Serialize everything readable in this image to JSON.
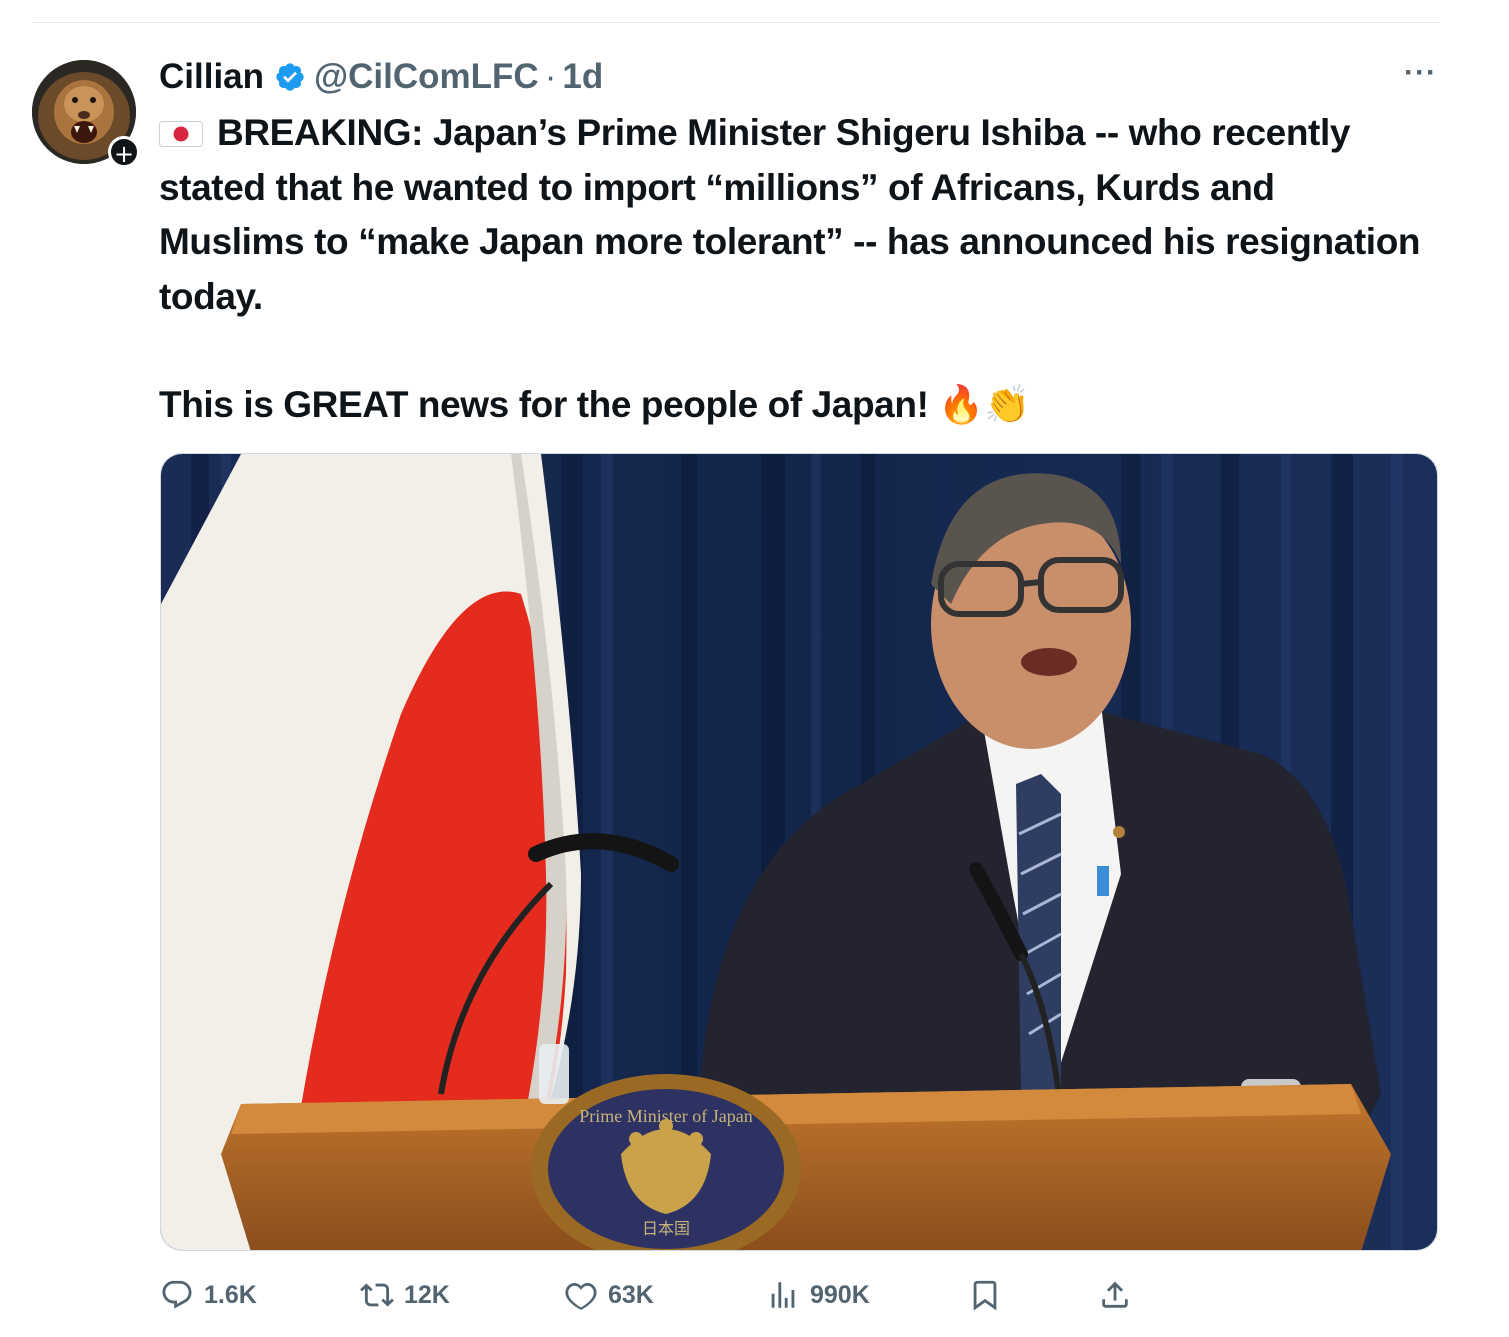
{
  "tweet": {
    "author": {
      "display_name": "Cillian",
      "handle": "@CilComLFC",
      "verified": true,
      "follow_badge": "+"
    },
    "time": "1d",
    "separator": "·",
    "more_label": "···",
    "flag_emoji": "japan-flag",
    "text_p1": "BREAKING: Japan’s Prime Minister Shigeru Ishiba -- who recently stated that he wanted to import “millions” of Africans, Kurds and Muslims to “make Japan more tolerant” -- has announced his resignation today.",
    "text_p2": "This is GREAT news for the people of Japan! 🔥👏",
    "media": {
      "podium_seal_text": "Prime Minister of Japan",
      "podium_seal_kanji": "日本国"
    },
    "actions": {
      "replies": "1.6K",
      "reposts": "12K",
      "likes": "63K",
      "views": "990K"
    }
  },
  "colors": {
    "text": "#0f1419",
    "muted": "#536471",
    "verified_blue": "#1d9bf0",
    "curtain_blue": "#17284e",
    "flag_red": "#e52a1e"
  }
}
